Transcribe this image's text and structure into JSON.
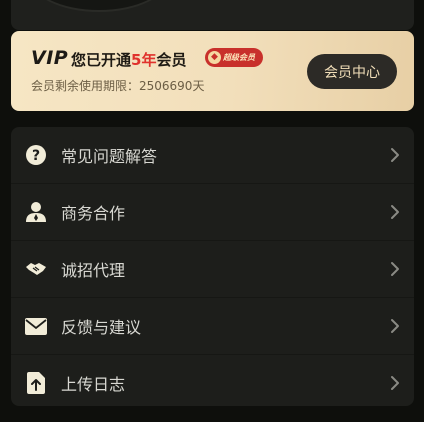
{
  "vip_card": {
    "logo": "VIP",
    "title_prefix": "您已开通",
    "title_years": "5年",
    "title_suffix": "会员",
    "badge_text": "超级会员",
    "remaining": "会员剩余使用期限：2506690天",
    "center_button": "会员中心"
  },
  "menu": {
    "items": [
      {
        "label": "常见问题解答",
        "icon": "question-icon"
      },
      {
        "label": "商务合作",
        "icon": "person-icon"
      },
      {
        "label": "诚招代理",
        "icon": "handshake-icon"
      },
      {
        "label": "反馈与建议",
        "icon": "mail-icon"
      },
      {
        "label": "上传日志",
        "icon": "upload-file-icon"
      }
    ]
  }
}
